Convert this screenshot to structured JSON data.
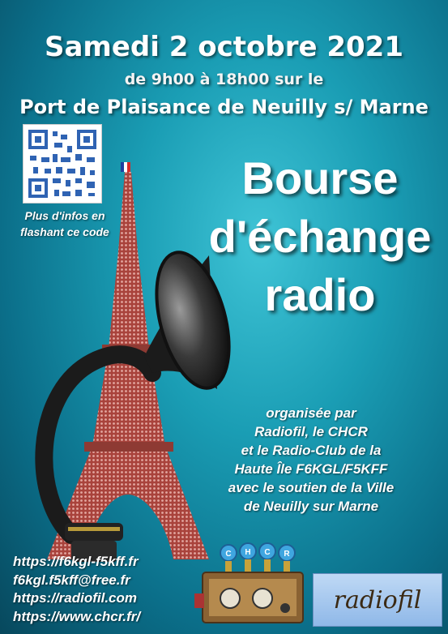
{
  "date": "Samedi 2 octobre 2021",
  "hours": "de 9h00 à 18h00 sur le",
  "place": "Port de Plaisance de Neuilly s/ Marne",
  "qr_note": [
    "Plus d'infos en",
    "flashant ce code"
  ],
  "title_lines": [
    "Bourse",
    "d'échange",
    "radio"
  ],
  "organizers": [
    "organisée par",
    "Radiofil, le CHCR",
    "et le Radio-Club de la",
    "Haute Île F6KGL/F5KFF",
    "avec le soutien de la Ville",
    "de  Neuilly sur Marne"
  ],
  "links": [
    "https://f6kgl-f5kff.fr",
    "f6kgl.f5kff@free.fr",
    "https://radiofil.com",
    "https://www.chcr.fr/"
  ],
  "chcr_letters": [
    "C",
    "H",
    "C",
    "R"
  ],
  "radiofil_logo": "radiofil",
  "colors": {
    "background": "#1a9db4",
    "text": "#ffffff",
    "tower": "#b5524a",
    "horn": "#1b1b1b"
  },
  "icons": [
    "qr-code-icon",
    "french-flag-icon",
    "eiffel-tower-icon",
    "gramophone-horn-icon",
    "vintage-radio-icon"
  ]
}
